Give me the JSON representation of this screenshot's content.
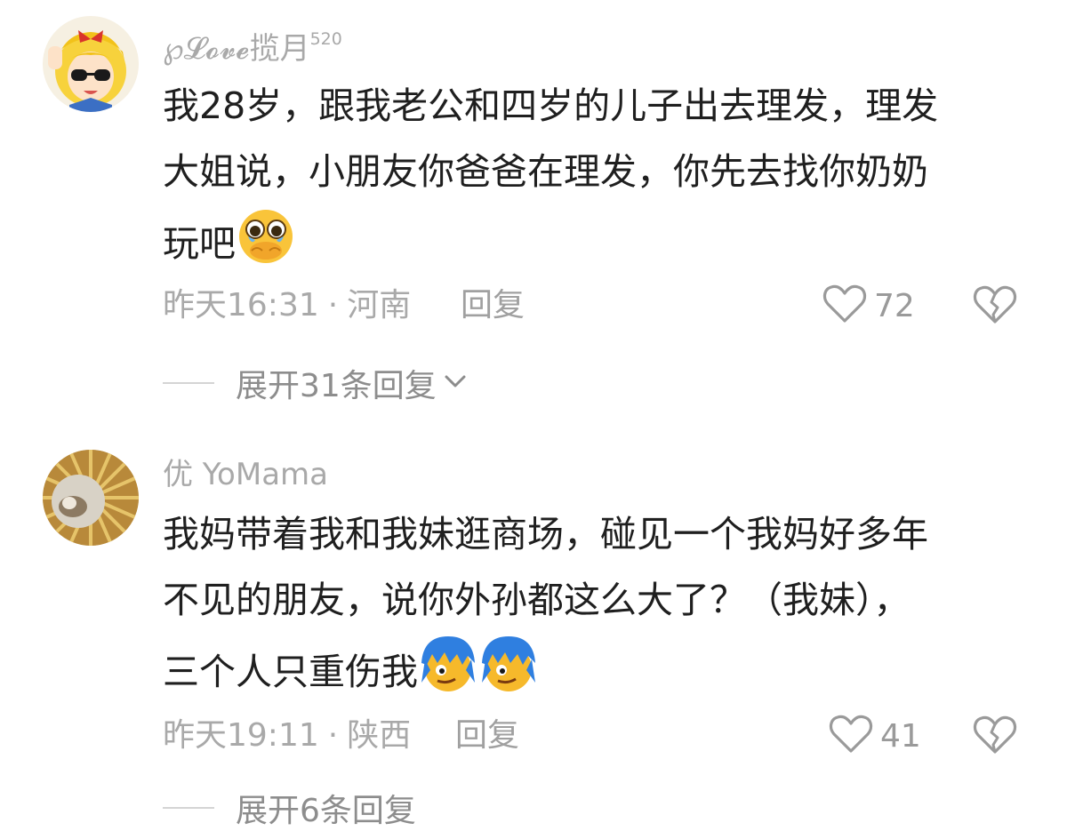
{
  "comments": [
    {
      "username": "℘𝓛𝓸𝓿𝓮揽月",
      "badge": "520",
      "lines": [
        "我28岁，跟我老公和四岁的儿子出去理发，理发",
        "大姐说，小朋友你爸爸在理发，你先去找你奶奶",
        "玩吧"
      ],
      "emoji": "crying-face-emoji",
      "time": "昨天16:31",
      "separator": "·",
      "location": "河南",
      "reply_label": "回复",
      "likes": "72",
      "expand_label": "展开31条回复"
    },
    {
      "username": "优 YoMama",
      "badge": "",
      "lines": [
        "我妈带着我和我妹逛商场，碰见一个我妈好多年",
        "不见的朋友，说你外孙都这么大了？（我妹），",
        "三个人只重伤我"
      ],
      "emoji": "blue-hair-face-emoji",
      "time": "昨天19:11",
      "separator": "·",
      "location": "陕西",
      "reply_label": "回复",
      "likes": "41",
      "expand_label": "展开6条回复"
    }
  ],
  "colors": {
    "text": "#1f1f1f",
    "muted": "#a9a9a9",
    "icon": "#9a9a9a"
  },
  "icons": [
    "heart-outline-icon",
    "broken-heart-icon",
    "chevron-down-icon"
  ]
}
